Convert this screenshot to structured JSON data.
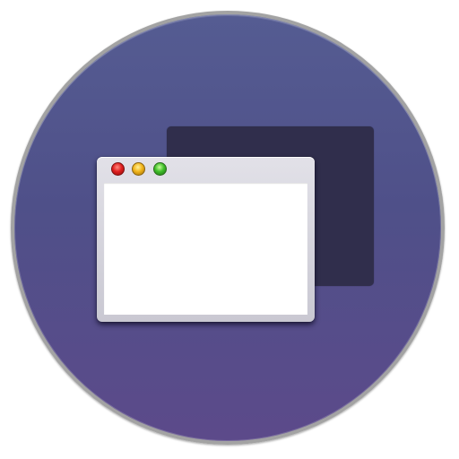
{
  "icon": {
    "semantic_name": "windows-overlap-icon",
    "colors": {
      "disc_top": "#555c92",
      "disc_bottom": "#5c4a8a",
      "disc_border": "#a3a3a3",
      "back_window": "#302e4c",
      "front_window_frame": "#d6d5de",
      "front_window_content": "#ffffff",
      "close_button": "#e02020",
      "minimize_button": "#f2b51b",
      "zoom_button": "#3fbe2a"
    },
    "front_window": {
      "buttons": [
        {
          "role": "close",
          "icon": "close-dot-icon"
        },
        {
          "role": "minimize",
          "icon": "minimize-dot-icon"
        },
        {
          "role": "zoom",
          "icon": "zoom-dot-icon"
        }
      ]
    }
  }
}
